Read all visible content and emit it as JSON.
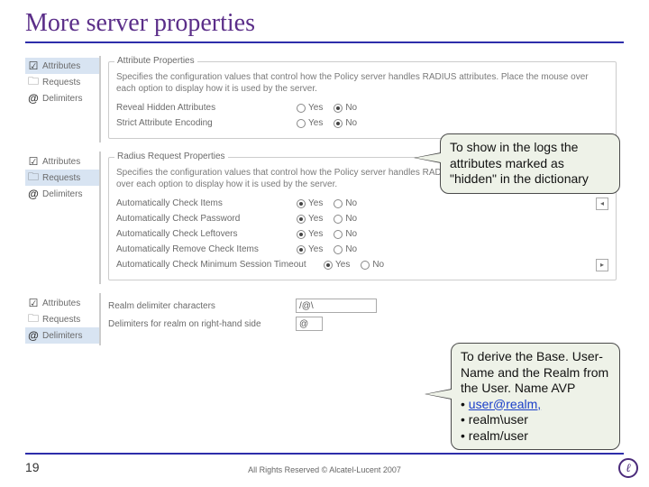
{
  "title": "More server properties",
  "sidebar": {
    "items": [
      {
        "label": "Attributes"
      },
      {
        "label": "Requests"
      },
      {
        "label": "Delimiters"
      }
    ]
  },
  "panels": {
    "attributes": {
      "group": "Attribute Properties",
      "desc": "Specifies the configuration values that control how the Policy server handles RADIUS attributes. Place the mouse over each option to display how it is used by the server.",
      "rows": [
        {
          "label": "Reveal Hidden Attributes",
          "yes": "Yes",
          "no": "No",
          "selected": "no"
        },
        {
          "label": "Strict Attribute Encoding",
          "yes": "Yes",
          "no": "No",
          "selected": "no"
        }
      ]
    },
    "requests": {
      "group": "Radius Request Properties",
      "desc": "Specifies the configuration values that control how the Policy server handles RADIUS requests (packets). Place the mouse over each option to display how it is used by the server.",
      "rows": [
        {
          "label": "Automatically Check Items",
          "yes": "Yes",
          "no": "No",
          "selected": "yes"
        },
        {
          "label": "Automatically Check Password",
          "yes": "Yes",
          "no": "No",
          "selected": "yes"
        },
        {
          "label": "Automatically Check Leftovers",
          "yes": "Yes",
          "no": "No",
          "selected": "yes"
        },
        {
          "label": "Automatically Remove Check Items",
          "yes": "Yes",
          "no": "No",
          "selected": "yes"
        },
        {
          "label": "Automatically Check Minimum Session Timeout",
          "yes": "Yes",
          "no": "No",
          "selected": "yes"
        }
      ]
    },
    "delimiters": {
      "fields": [
        {
          "label": "Realm delimiter characters",
          "value": "/@\\"
        },
        {
          "label": "Delimiters for realm on right-hand side",
          "value": "@"
        }
      ]
    }
  },
  "callouts": {
    "c1": "To show in the logs the attributes marked as \"hidden\" in the dictionary",
    "c2": {
      "text": "To derive the Base. User-Name and the Realm from the User. Name AVP",
      "items": [
        "user@realm,",
        "realm\\user",
        "realm/user"
      ]
    }
  },
  "footer": {
    "page": "19",
    "copyright": "All Rights Reserved © Alcatel-Lucent 2007"
  }
}
